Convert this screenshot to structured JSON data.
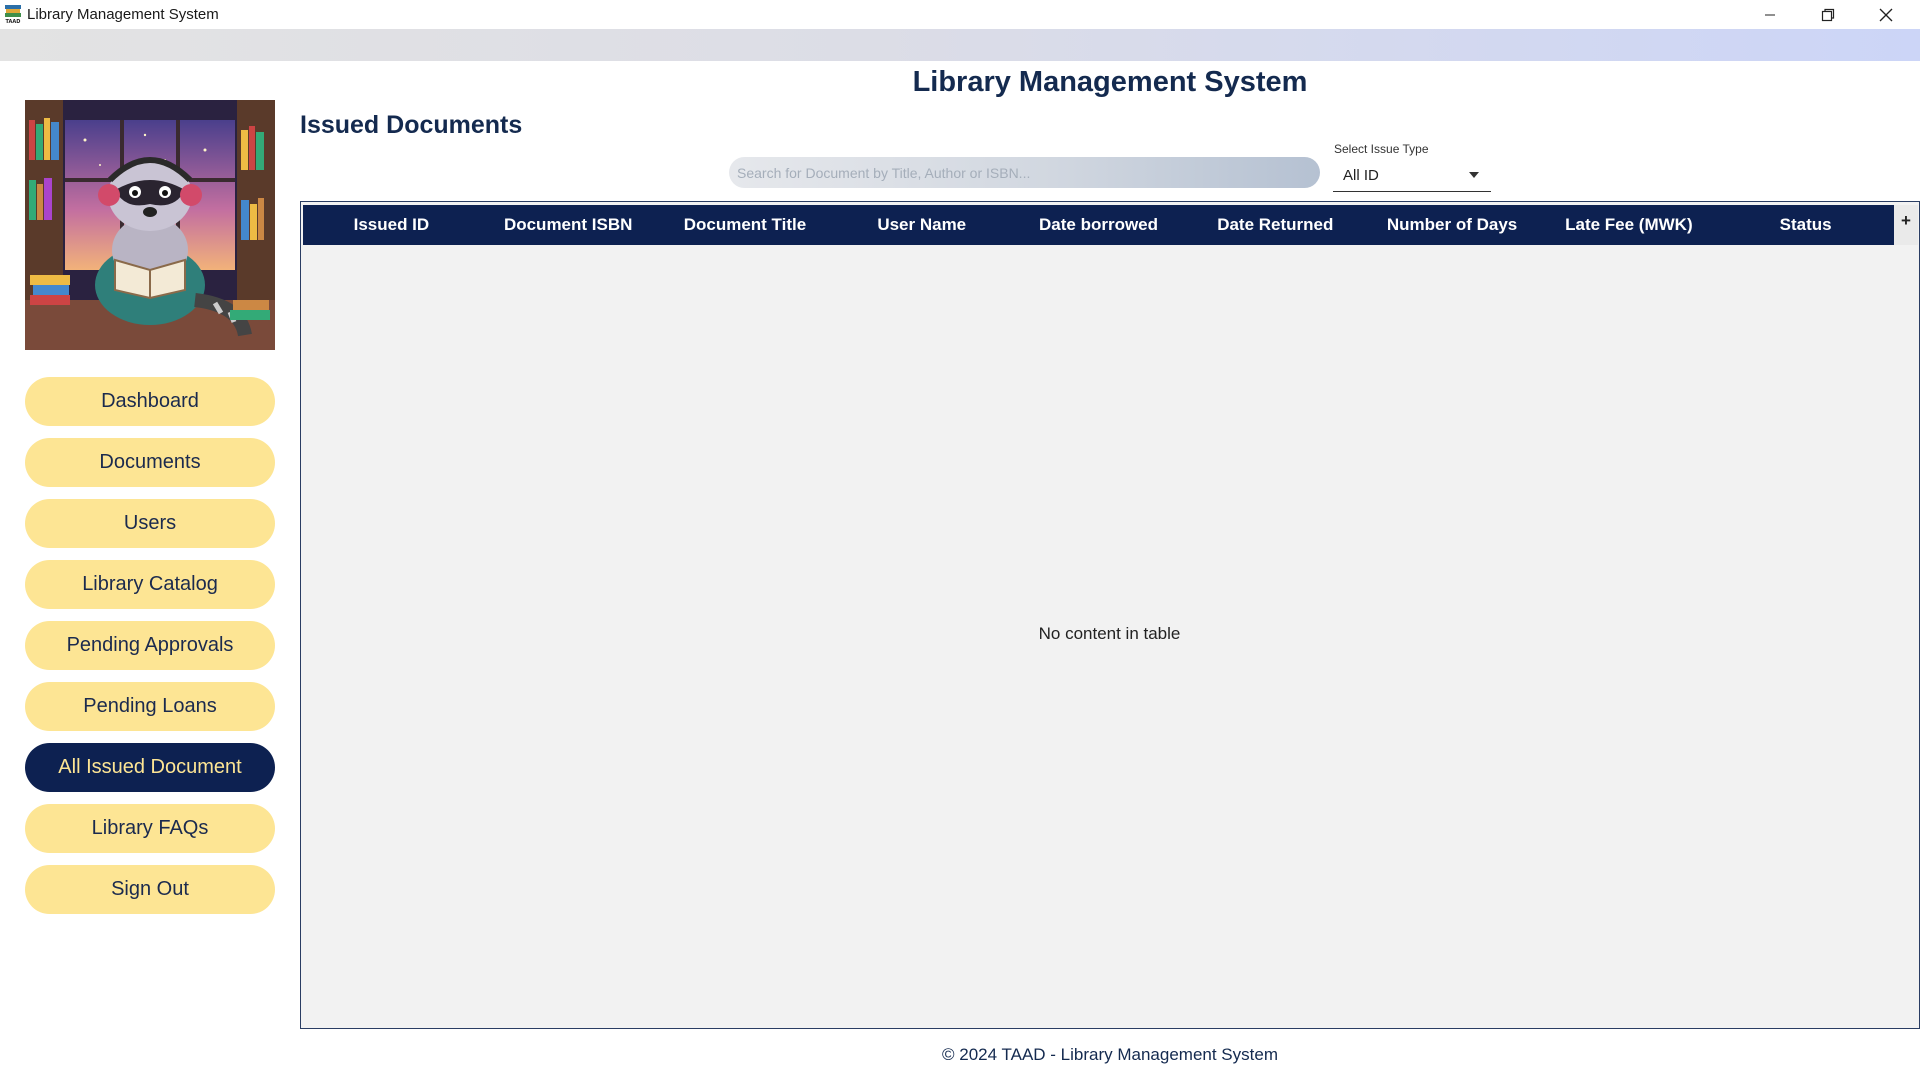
{
  "window": {
    "title": "Library Management System",
    "controls": [
      "minimize-icon",
      "restore-icon",
      "close-icon"
    ]
  },
  "app_title": "Library Management System",
  "section_title": "Issued Documents",
  "sidebar": {
    "items": [
      {
        "label": "Dashboard",
        "active": false
      },
      {
        "label": "Documents",
        "active": false
      },
      {
        "label": "Users",
        "active": false
      },
      {
        "label": "Library Catalog",
        "active": false
      },
      {
        "label": "Pending Approvals",
        "active": false
      },
      {
        "label": "Pending Loans",
        "active": false
      },
      {
        "label": "All Issued Document",
        "active": true
      },
      {
        "label": "Library FAQs",
        "active": false
      },
      {
        "label": "Sign Out",
        "active": false
      }
    ]
  },
  "search": {
    "placeholder": "Search for Document by Title, Author or ISBN...",
    "value": ""
  },
  "issue_type": {
    "label": "Select Issue Type",
    "selected": "All ID"
  },
  "table": {
    "columns": [
      "Issued ID",
      "Document ISBN",
      "Document Title",
      "User Name",
      "Date borrowed",
      "Date Returned",
      "Number of Days",
      "Late Fee (MWK)",
      "Status"
    ],
    "rows": [],
    "add_column_symbol": "+",
    "empty_message": "No content in table"
  },
  "footer": "© 2024 TAAD - Library Management System",
  "colors": {
    "navy": "#0d2151",
    "nav_button": "#fde594",
    "table_background": "#f2f2f2"
  }
}
